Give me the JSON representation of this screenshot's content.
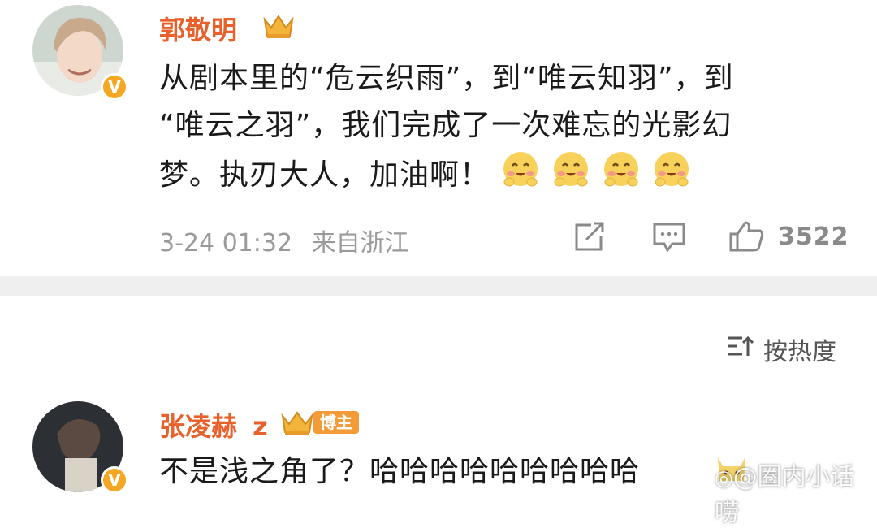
{
  "post": {
    "author": "郭敬明",
    "content_lines": [
      "从剧本里的“危云织雨”，到“唯云知羽”，到",
      "“唯云之羽”，我们完成了一次难忘的光影幻",
      "梦。执刃大人，加油啊！"
    ],
    "emoji_icon": "smile-blush-emoji",
    "timestamp": "3-24 01:32",
    "location": "来自浙江",
    "like_count": "3522",
    "verified": "V"
  },
  "sort": {
    "label": "按热度"
  },
  "comment": {
    "author": "张凌赫",
    "author_suffix": "z",
    "badge": "博主",
    "text": "不是浅之角了？哈哈哈哈哈哈哈哈哈",
    "verified": "V"
  },
  "watermark": {
    "text": "@圈内小话唠"
  },
  "colors": {
    "username": "#e8612b",
    "badge": "#f5a623",
    "meta": "#9a9a9a"
  }
}
